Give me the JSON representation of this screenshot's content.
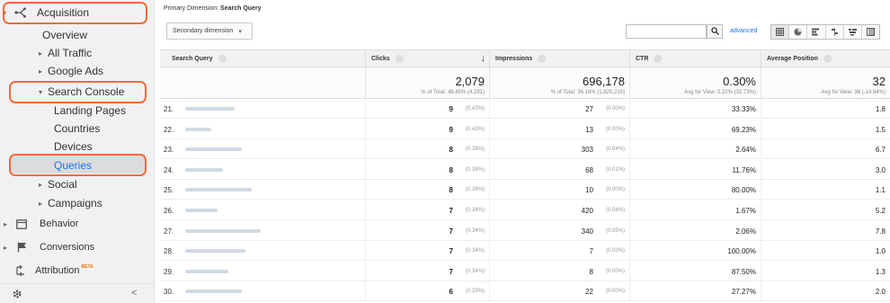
{
  "sidebar": {
    "acquisition": "Acquisition",
    "overview": "Overview",
    "all_traffic": "All Traffic",
    "google_ads": "Google Ads",
    "search_console": "Search Console",
    "landing_pages": "Landing Pages",
    "countries": "Countries",
    "devices": "Devices",
    "queries": "Queries",
    "social": "Social",
    "campaigns": "Campaigns",
    "behavior": "Behavior",
    "conversions": "Conversions",
    "attribution": "Attribution",
    "beta": "BETA",
    "collapse": "<"
  },
  "toolbar": {
    "primary_dimension_label": "Primary Dimension:",
    "primary_dimension_value": "Search Query",
    "secondary_dimension": "Secondary dimension",
    "advanced": "advanced"
  },
  "table": {
    "headers": [
      "Search Query",
      "Clicks",
      "Impressions",
      "CTR",
      "Average Position"
    ],
    "totals": {
      "clicks": "2,079",
      "clicks_sub": "% of Total: 48.45% (4,291)",
      "impressions": "696,178",
      "impressions_sub": "% of Total: 36.16% (1,925,215)",
      "ctr": "0.30%",
      "ctr_sub": "Avg for View: 0.22% (32.73%)",
      "avg_position": "32",
      "avg_position_sub": "Avg for View: 38 (-14.94%)"
    },
    "rows": [
      {
        "num": "21.",
        "clicks": "9",
        "clicks_pct": "(0.43%)",
        "impressions": "27",
        "impressions_pct": "(0.00%)",
        "ctr": "33.33%",
        "pos": "1.8"
      },
      {
        "num": "22.",
        "clicks": "9",
        "clicks_pct": "(0.43%)",
        "impressions": "13",
        "impressions_pct": "(0.00%)",
        "ctr": "69.23%",
        "pos": "1.5"
      },
      {
        "num": "23.",
        "clicks": "8",
        "clicks_pct": "(0.38%)",
        "impressions": "303",
        "impressions_pct": "(0.04%)",
        "ctr": "2.64%",
        "pos": "6.7"
      },
      {
        "num": "24.",
        "clicks": "8",
        "clicks_pct": "(0.38%)",
        "impressions": "68",
        "impressions_pct": "(0.01%)",
        "ctr": "11.76%",
        "pos": "3.0"
      },
      {
        "num": "25.",
        "clicks": "8",
        "clicks_pct": "(0.38%)",
        "impressions": "10",
        "impressions_pct": "(0.00%)",
        "ctr": "80.00%",
        "pos": "1.1"
      },
      {
        "num": "26.",
        "clicks": "7",
        "clicks_pct": "(0.34%)",
        "impressions": "420",
        "impressions_pct": "(0.06%)",
        "ctr": "1.67%",
        "pos": "5.2"
      },
      {
        "num": "27.",
        "clicks": "7",
        "clicks_pct": "(0.34%)",
        "impressions": "340",
        "impressions_pct": "(0.05%)",
        "ctr": "2.06%",
        "pos": "7.8"
      },
      {
        "num": "28.",
        "clicks": "7",
        "clicks_pct": "(0.34%)",
        "impressions": "7",
        "impressions_pct": "(0.00%)",
        "ctr": "100.00%",
        "pos": "1.0"
      },
      {
        "num": "29.",
        "clicks": "7",
        "clicks_pct": "(0.34%)",
        "impressions": "8",
        "impressions_pct": "(0.00%)",
        "ctr": "87.50%",
        "pos": "1.3"
      },
      {
        "num": "30.",
        "clicks": "6",
        "clicks_pct": "(0.29%)",
        "impressions": "22",
        "impressions_pct": "(0.00%)",
        "ctr": "27.27%",
        "pos": "2.0"
      }
    ]
  },
  "icons": {
    "acquisition": "acquisition-icon",
    "behavior": "behavior-icon",
    "conversions": "flag-icon",
    "attribution": "attribution-icon",
    "settings": "gear-icon",
    "search": "search-icon"
  },
  "colors": {
    "highlight": "#ef6c3b",
    "link": "#1a73e8"
  }
}
